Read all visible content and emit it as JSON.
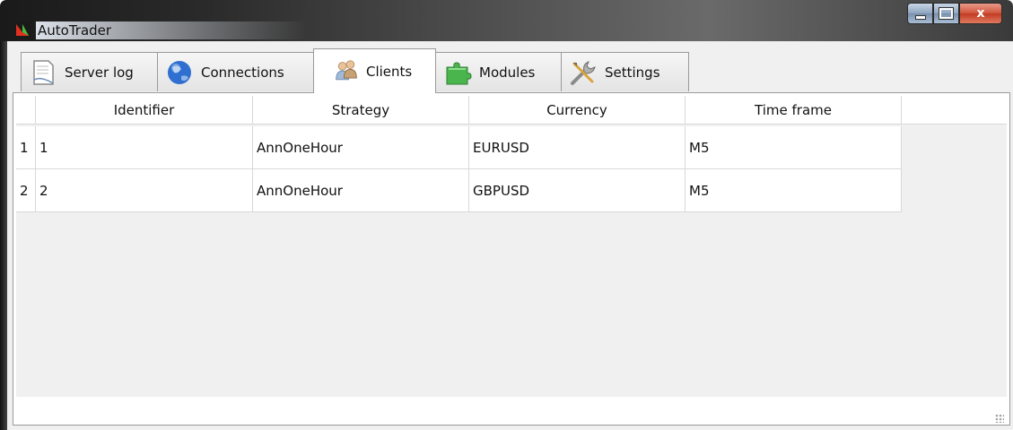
{
  "window": {
    "title": "AutoTrader",
    "close_glyph": "x"
  },
  "tabs": [
    {
      "label": "Server log",
      "icon": "document-icon"
    },
    {
      "label": "Connections",
      "icon": "globe-icon"
    },
    {
      "label": "Clients",
      "icon": "users-icon"
    },
    {
      "label": "Modules",
      "icon": "puzzle-icon"
    },
    {
      "label": "Settings",
      "icon": "tools-icon"
    }
  ],
  "active_tab": "Clients",
  "table": {
    "columns": [
      "Identifier",
      "Strategy",
      "Currency",
      "Time frame"
    ],
    "rows": [
      {
        "num": "1",
        "cells": [
          "1",
          "AnnOneHour",
          "EURUSD",
          "M5"
        ]
      },
      {
        "num": "2",
        "cells": [
          "2",
          "AnnOneHour",
          "GBPUSD",
          "M5"
        ]
      }
    ]
  }
}
